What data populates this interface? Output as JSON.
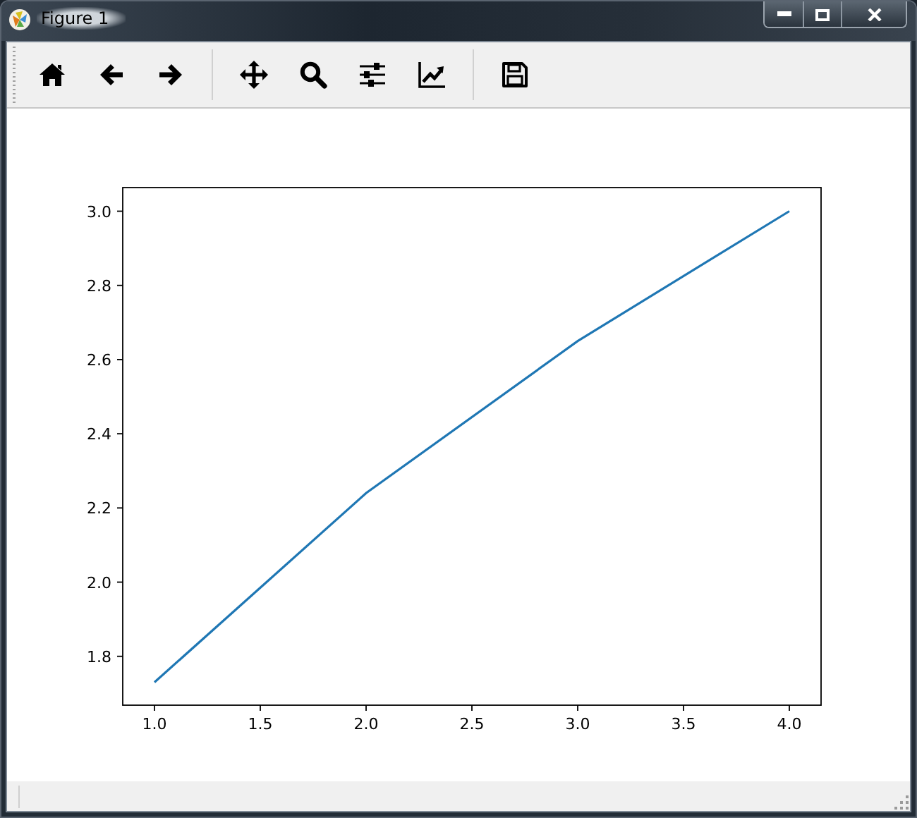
{
  "window": {
    "title": "Figure 1"
  },
  "toolbar": {
    "groups": [
      {
        "buttons": [
          {
            "kind": "home"
          },
          {
            "kind": "back"
          },
          {
            "kind": "forward"
          }
        ]
      },
      {
        "buttons": [
          {
            "kind": "pan"
          },
          {
            "kind": "zoom"
          },
          {
            "kind": "subplots"
          },
          {
            "kind": "customize"
          }
        ]
      },
      {
        "buttons": [
          {
            "kind": "save"
          }
        ]
      }
    ]
  },
  "figure": {
    "chart_data": {
      "type": "line",
      "x": [
        1,
        2,
        3,
        4
      ],
      "series": [
        {
          "color": "#1f77b4",
          "values": [
            1.73,
            2.24,
            2.65,
            3.0
          ]
        }
      ],
      "xlim": [
        0.85,
        4.15
      ],
      "ylim": [
        1.6683,
        3.0637
      ],
      "xticks": [
        {
          "value": 1,
          "label": "1.0"
        },
        {
          "value": 1.5,
          "label": "1.5"
        },
        {
          "value": 2,
          "label": "2.0"
        },
        {
          "value": 2.5,
          "label": "2.5"
        },
        {
          "value": 3,
          "label": "3.0"
        },
        {
          "value": 3.5,
          "label": "3.5"
        },
        {
          "value": 4,
          "label": "4.0"
        }
      ],
      "yticks": [
        {
          "value": 1.8,
          "label": "1.8"
        },
        {
          "value": 2.0,
          "label": "2.0"
        },
        {
          "value": 2.2,
          "label": "2.2"
        },
        {
          "value": 2.4,
          "label": "2.4"
        },
        {
          "value": 2.6,
          "label": "2.6"
        },
        {
          "value": 2.8,
          "label": "2.8"
        },
        {
          "value": 3.0,
          "label": "3.0"
        }
      ]
    }
  }
}
